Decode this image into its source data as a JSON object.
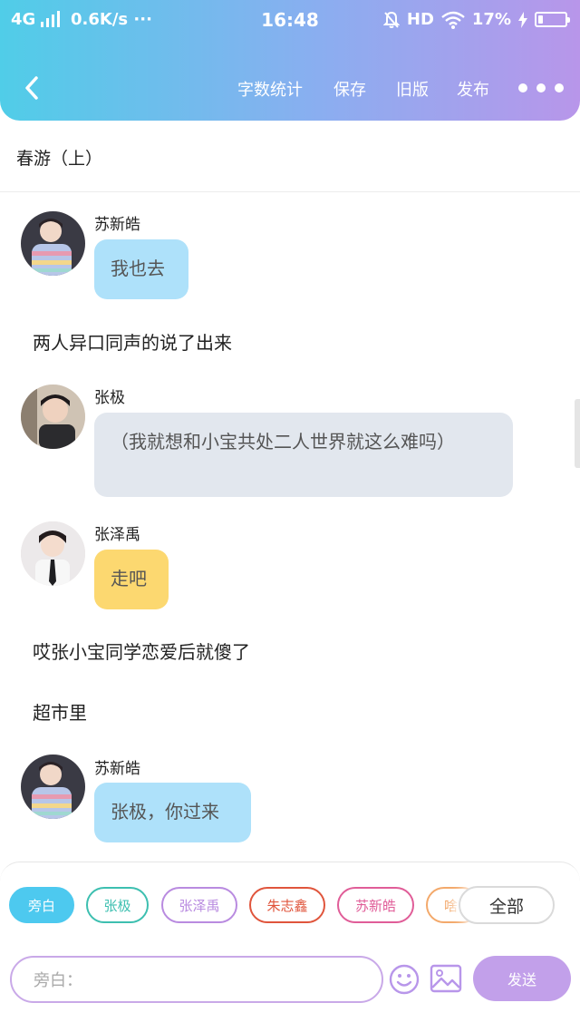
{
  "status_bar": {
    "network": "4G",
    "speed": "0.6K/s",
    "dots": "···",
    "time": "16:48",
    "hd": "HD",
    "battery": "17%",
    "battery_level": 0.17
  },
  "toolbar": {
    "items": [
      "字数统计",
      "保存",
      "旧版",
      "发布"
    ]
  },
  "story": {
    "title": "春游（上）"
  },
  "messages": [
    {
      "type": "dialog",
      "speaker": "苏新皓",
      "text": "我也去",
      "color": "#aee1fa"
    },
    {
      "type": "narration",
      "text": "两人异口同声的说了出来"
    },
    {
      "type": "dialog",
      "speaker": "张极",
      "text": "（我就想和小宝共处二人世界就这么难吗）",
      "color": "#e2e7ee"
    },
    {
      "type": "dialog",
      "speaker": "张泽禹",
      "text": "走吧",
      "color": "#fcd870"
    },
    {
      "type": "narration",
      "text": "哎张小宝同学恋爱后就傻了"
    },
    {
      "type": "narration",
      "text": "超市里"
    },
    {
      "type": "dialog",
      "speaker": "苏新皓",
      "text": "张极，你过来",
      "color": "#aee1fa"
    }
  ],
  "characters": [
    {
      "name": "旁白",
      "color": "#4dc9ef",
      "selected": true
    },
    {
      "name": "张极",
      "color": "#3dbfb0"
    },
    {
      "name": "张泽禹",
      "color": "#b98be0"
    },
    {
      "name": "朱志鑫",
      "color": "#e0553c"
    },
    {
      "name": "苏新皓",
      "color": "#e05d98"
    },
    {
      "name": "啥",
      "color": "#f3a96b"
    }
  ],
  "all_label": "全部",
  "input": {
    "placeholder": "旁白："
  },
  "send_label": "发送"
}
